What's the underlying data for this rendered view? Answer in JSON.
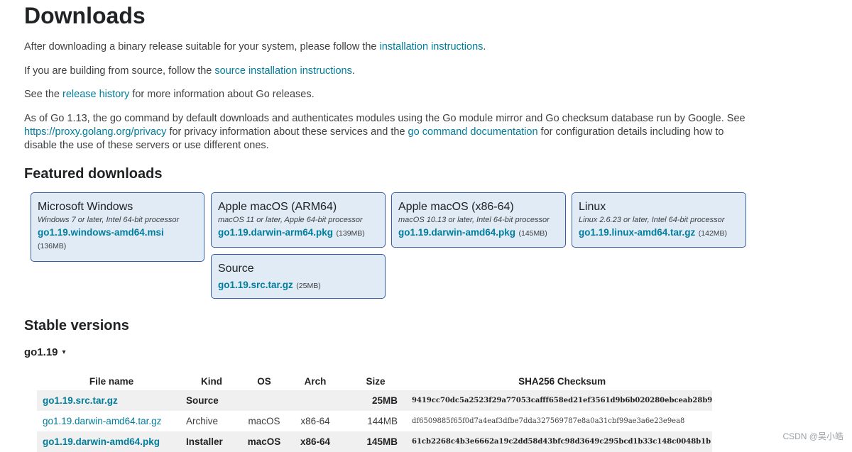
{
  "page": {
    "title": "Downloads",
    "intro1": {
      "pre": "After downloading a binary release suitable for your system, please follow the ",
      "link": "installation instructions",
      "post": "."
    },
    "intro2": {
      "pre": "If you are building from source, follow the ",
      "link": "source installation instructions",
      "post": "."
    },
    "intro3": {
      "pre": "See the ",
      "link": "release history",
      "post": " for more information about Go releases."
    },
    "intro4": {
      "pre": "As of Go 1.13, the go command by default downloads and authenticates modules using the Go module mirror and Go checksum database run by Google. See ",
      "link1": "https://proxy.golang.org/privacy",
      "mid": " for privacy information about these services and the ",
      "link2": "go command documentation",
      "post": " for configuration details including how to disable the use of these servers or use different ones."
    }
  },
  "featured": {
    "heading": "Featured downloads",
    "cards": [
      {
        "title": "Microsoft Windows",
        "req": "Windows 7 or later, Intel 64-bit processor",
        "file": "go1.19.windows-amd64.msi",
        "size": "(136MB)"
      },
      {
        "title": "Apple macOS (ARM64)",
        "req": "macOS 11 or later, Apple 64-bit processor",
        "file": "go1.19.darwin-arm64.pkg",
        "size": "(139MB)"
      },
      {
        "title": "Apple macOS (x86-64)",
        "req": "macOS 10.13 or later, Intel 64-bit processor",
        "file": "go1.19.darwin-amd64.pkg",
        "size": "(145MB)"
      },
      {
        "title": "Linux",
        "req": "Linux 2.6.23 or later, Intel 64-bit processor",
        "file": "go1.19.linux-amd64.tar.gz",
        "size": "(142MB)"
      },
      {
        "title": "Source",
        "req": "",
        "file": "go1.19.src.tar.gz",
        "size": "(25MB)"
      }
    ]
  },
  "stable": {
    "heading": "Stable versions",
    "version": "go1.19",
    "caret": "▾",
    "columns": [
      "File name",
      "Kind",
      "OS",
      "Arch",
      "Size",
      "SHA256 Checksum"
    ],
    "rows": [
      {
        "name": "go1.19.src.tar.gz",
        "kind": "Source",
        "os": "",
        "arch": "",
        "size": "25MB",
        "sha": "9419cc70dc5a2523f29a77053cafff658ed21ef3561d9b6b020280ebceab28b9"
      },
      {
        "name": "go1.19.darwin-amd64.tar.gz",
        "kind": "Archive",
        "os": "macOS",
        "arch": "x86-64",
        "size": "144MB",
        "sha": "df6509885f65f0d7a4eaf3dfbe7dda327569787e8a0a31cbf99ae3a6e23e9ea8"
      },
      {
        "name": "go1.19.darwin-amd64.pkg",
        "kind": "Installer",
        "os": "macOS",
        "arch": "x86-64",
        "size": "145MB",
        "sha": "61cb2268c4b3e6662a19c2dd58d43bfc98d3649c295bcd1b33c148c0048b1b"
      }
    ]
  },
  "watermark": "CSDN @吴小皓"
}
